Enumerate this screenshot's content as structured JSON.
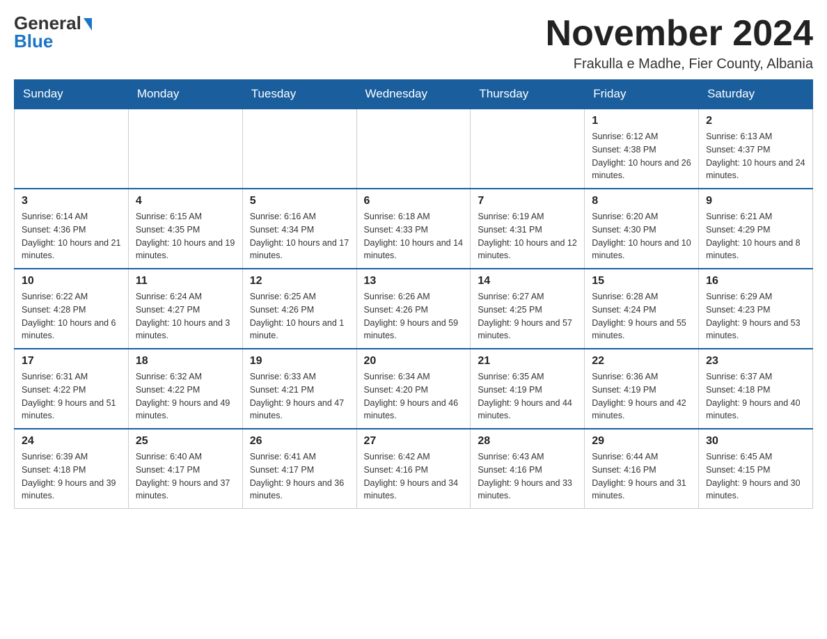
{
  "header": {
    "logo_general": "General",
    "logo_blue": "Blue",
    "month_title": "November 2024",
    "location": "Frakulla e Madhe, Fier County, Albania"
  },
  "weekdays": [
    "Sunday",
    "Monday",
    "Tuesday",
    "Wednesday",
    "Thursday",
    "Friday",
    "Saturday"
  ],
  "weeks": [
    {
      "days": [
        {
          "number": "",
          "info": ""
        },
        {
          "number": "",
          "info": ""
        },
        {
          "number": "",
          "info": ""
        },
        {
          "number": "",
          "info": ""
        },
        {
          "number": "",
          "info": ""
        },
        {
          "number": "1",
          "info": "Sunrise: 6:12 AM\nSunset: 4:38 PM\nDaylight: 10 hours and 26 minutes."
        },
        {
          "number": "2",
          "info": "Sunrise: 6:13 AM\nSunset: 4:37 PM\nDaylight: 10 hours and 24 minutes."
        }
      ]
    },
    {
      "days": [
        {
          "number": "3",
          "info": "Sunrise: 6:14 AM\nSunset: 4:36 PM\nDaylight: 10 hours and 21 minutes."
        },
        {
          "number": "4",
          "info": "Sunrise: 6:15 AM\nSunset: 4:35 PM\nDaylight: 10 hours and 19 minutes."
        },
        {
          "number": "5",
          "info": "Sunrise: 6:16 AM\nSunset: 4:34 PM\nDaylight: 10 hours and 17 minutes."
        },
        {
          "number": "6",
          "info": "Sunrise: 6:18 AM\nSunset: 4:33 PM\nDaylight: 10 hours and 14 minutes."
        },
        {
          "number": "7",
          "info": "Sunrise: 6:19 AM\nSunset: 4:31 PM\nDaylight: 10 hours and 12 minutes."
        },
        {
          "number": "8",
          "info": "Sunrise: 6:20 AM\nSunset: 4:30 PM\nDaylight: 10 hours and 10 minutes."
        },
        {
          "number": "9",
          "info": "Sunrise: 6:21 AM\nSunset: 4:29 PM\nDaylight: 10 hours and 8 minutes."
        }
      ]
    },
    {
      "days": [
        {
          "number": "10",
          "info": "Sunrise: 6:22 AM\nSunset: 4:28 PM\nDaylight: 10 hours and 6 minutes."
        },
        {
          "number": "11",
          "info": "Sunrise: 6:24 AM\nSunset: 4:27 PM\nDaylight: 10 hours and 3 minutes."
        },
        {
          "number": "12",
          "info": "Sunrise: 6:25 AM\nSunset: 4:26 PM\nDaylight: 10 hours and 1 minute."
        },
        {
          "number": "13",
          "info": "Sunrise: 6:26 AM\nSunset: 4:26 PM\nDaylight: 9 hours and 59 minutes."
        },
        {
          "number": "14",
          "info": "Sunrise: 6:27 AM\nSunset: 4:25 PM\nDaylight: 9 hours and 57 minutes."
        },
        {
          "number": "15",
          "info": "Sunrise: 6:28 AM\nSunset: 4:24 PM\nDaylight: 9 hours and 55 minutes."
        },
        {
          "number": "16",
          "info": "Sunrise: 6:29 AM\nSunset: 4:23 PM\nDaylight: 9 hours and 53 minutes."
        }
      ]
    },
    {
      "days": [
        {
          "number": "17",
          "info": "Sunrise: 6:31 AM\nSunset: 4:22 PM\nDaylight: 9 hours and 51 minutes."
        },
        {
          "number": "18",
          "info": "Sunrise: 6:32 AM\nSunset: 4:22 PM\nDaylight: 9 hours and 49 minutes."
        },
        {
          "number": "19",
          "info": "Sunrise: 6:33 AM\nSunset: 4:21 PM\nDaylight: 9 hours and 47 minutes."
        },
        {
          "number": "20",
          "info": "Sunrise: 6:34 AM\nSunset: 4:20 PM\nDaylight: 9 hours and 46 minutes."
        },
        {
          "number": "21",
          "info": "Sunrise: 6:35 AM\nSunset: 4:19 PM\nDaylight: 9 hours and 44 minutes."
        },
        {
          "number": "22",
          "info": "Sunrise: 6:36 AM\nSunset: 4:19 PM\nDaylight: 9 hours and 42 minutes."
        },
        {
          "number": "23",
          "info": "Sunrise: 6:37 AM\nSunset: 4:18 PM\nDaylight: 9 hours and 40 minutes."
        }
      ]
    },
    {
      "days": [
        {
          "number": "24",
          "info": "Sunrise: 6:39 AM\nSunset: 4:18 PM\nDaylight: 9 hours and 39 minutes."
        },
        {
          "number": "25",
          "info": "Sunrise: 6:40 AM\nSunset: 4:17 PM\nDaylight: 9 hours and 37 minutes."
        },
        {
          "number": "26",
          "info": "Sunrise: 6:41 AM\nSunset: 4:17 PM\nDaylight: 9 hours and 36 minutes."
        },
        {
          "number": "27",
          "info": "Sunrise: 6:42 AM\nSunset: 4:16 PM\nDaylight: 9 hours and 34 minutes."
        },
        {
          "number": "28",
          "info": "Sunrise: 6:43 AM\nSunset: 4:16 PM\nDaylight: 9 hours and 33 minutes."
        },
        {
          "number": "29",
          "info": "Sunrise: 6:44 AM\nSunset: 4:16 PM\nDaylight: 9 hours and 31 minutes."
        },
        {
          "number": "30",
          "info": "Sunrise: 6:45 AM\nSunset: 4:15 PM\nDaylight: 9 hours and 30 minutes."
        }
      ]
    }
  ]
}
